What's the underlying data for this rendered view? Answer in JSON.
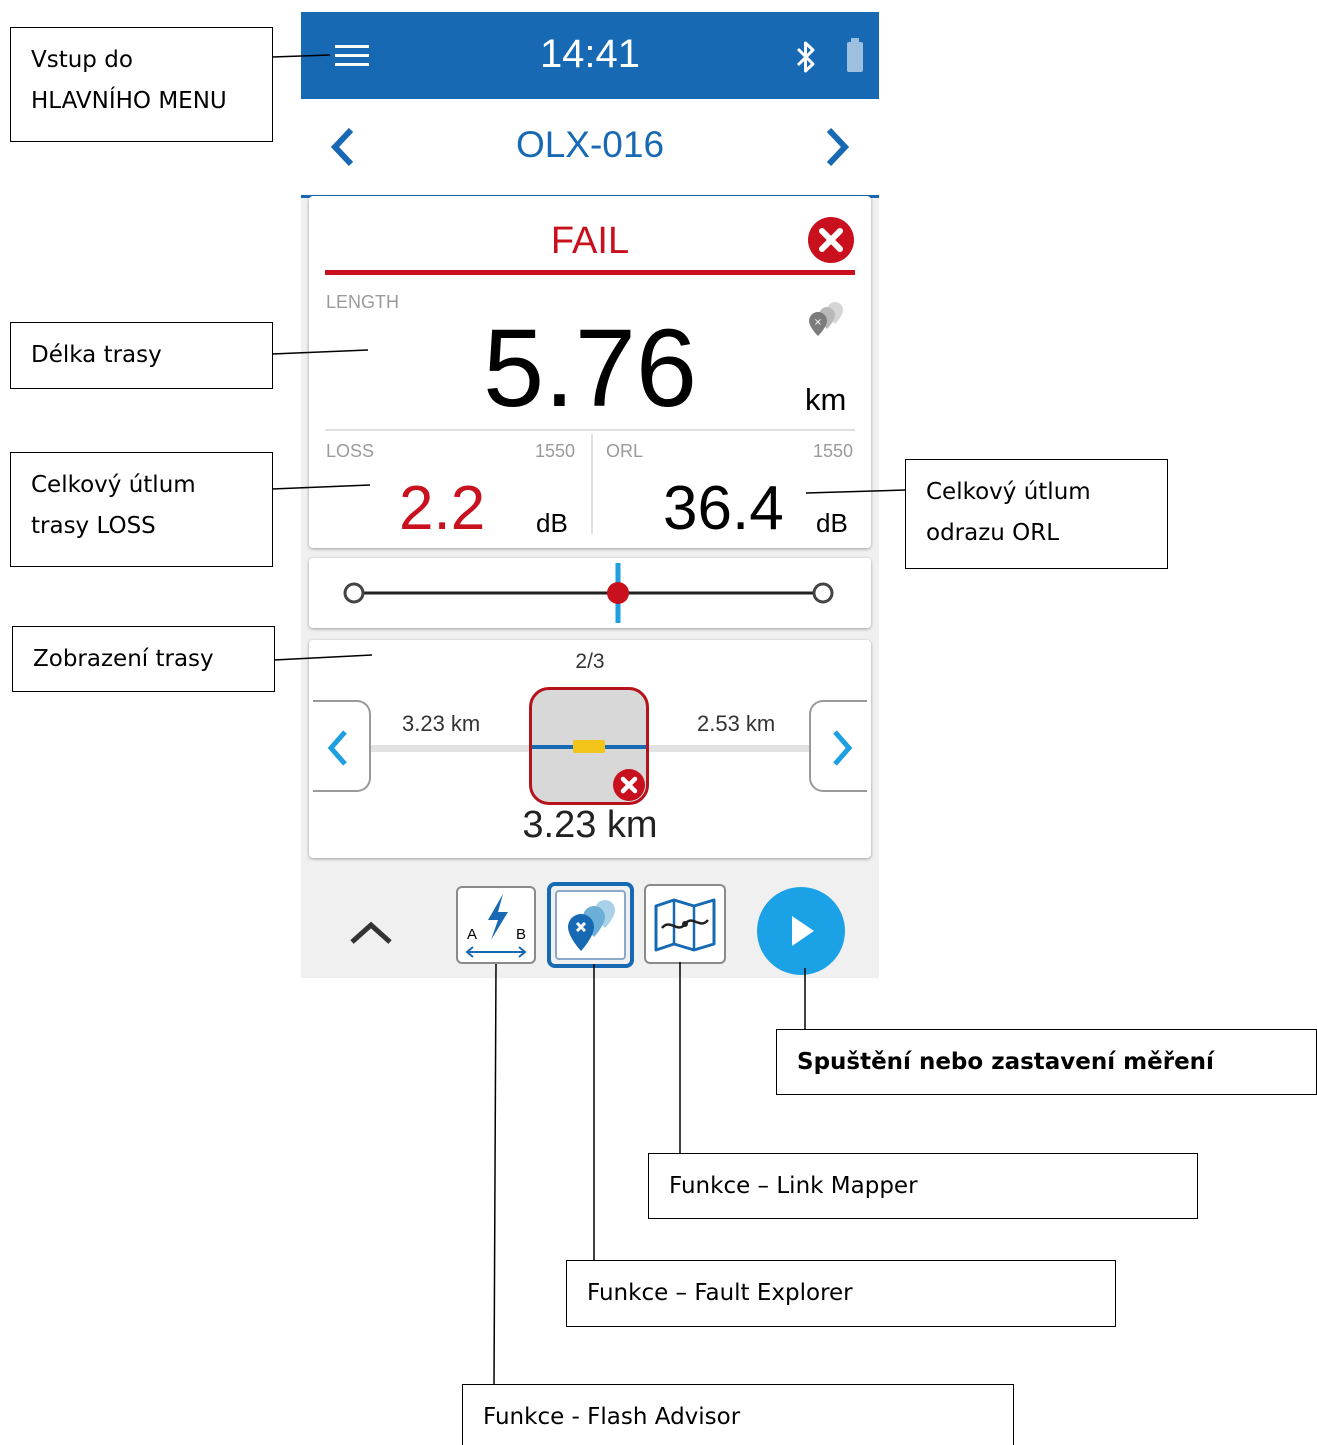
{
  "status_bar": {
    "time": "14:41"
  },
  "header": {
    "title": "OLX-016"
  },
  "result": {
    "status": "FAIL",
    "length_label": "LENGTH",
    "length_value": "5.76",
    "length_unit": "km",
    "loss_label": "LOSS",
    "loss_wavelength": "1550",
    "loss_value": "2.2",
    "loss_unit": "dB",
    "orl_label": "ORL",
    "orl_wavelength": "1550",
    "orl_value": "36.4",
    "orl_unit": "dB"
  },
  "trace": {
    "counter": "2/3",
    "left_distance": "3.23 km",
    "right_distance": "2.53 km",
    "event_distance": "3.23 km"
  },
  "toolbar": {
    "flash_advisor_a": "A",
    "flash_advisor_b": "B"
  },
  "callouts": {
    "main_menu": [
      "Vstup do",
      "HLAVNÍHO MENU"
    ],
    "route_length": "Délka trasy",
    "total_loss": [
      "Celkový útlum",
      "trasy LOSS"
    ],
    "total_orl": [
      "Celkový útlum",
      "odrazu ORL"
    ],
    "route_view": "Zobrazení trasy",
    "start_stop": "Spuštění nebo zastavení měření",
    "link_mapper": "Funkce – Link Mapper",
    "fault_explorer": "Funkce – Fault Explorer",
    "flash_advisor": "Funkce - Flash Advisor"
  },
  "colors": {
    "brand_blue": "#1669b2",
    "fail_red": "#c8101e",
    "play_blue": "#1ba1e6",
    "accent_blue": "#1ea0e0"
  }
}
